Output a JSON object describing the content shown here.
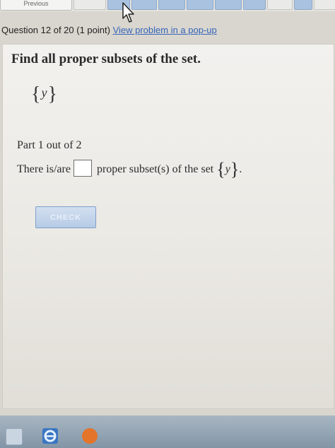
{
  "topnav": {
    "prev_label": "Previous",
    "question_boxes": 10
  },
  "header": {
    "question_info": "Question 12 of 20 (1 point)",
    "popup_link": "View problem in a pop-up"
  },
  "problem": {
    "title": "Find all proper subsets of the set.",
    "set": "{y}",
    "set_open": "{",
    "set_element": "y",
    "set_close": "}"
  },
  "part": {
    "label": "Part 1 out of 2",
    "statement_before": "There is/are",
    "answer_value": "",
    "statement_after": "proper subset(s) of the set",
    "end_punct": "."
  },
  "actions": {
    "check_label": "CHECK"
  },
  "colors": {
    "link": "#3564b8",
    "check_button": "#b7cbe6",
    "nav_box": "#a9c2e0"
  },
  "icons": [
    "cursor-arrow-icon",
    "ie-browser-icon",
    "firefox-icon"
  ]
}
